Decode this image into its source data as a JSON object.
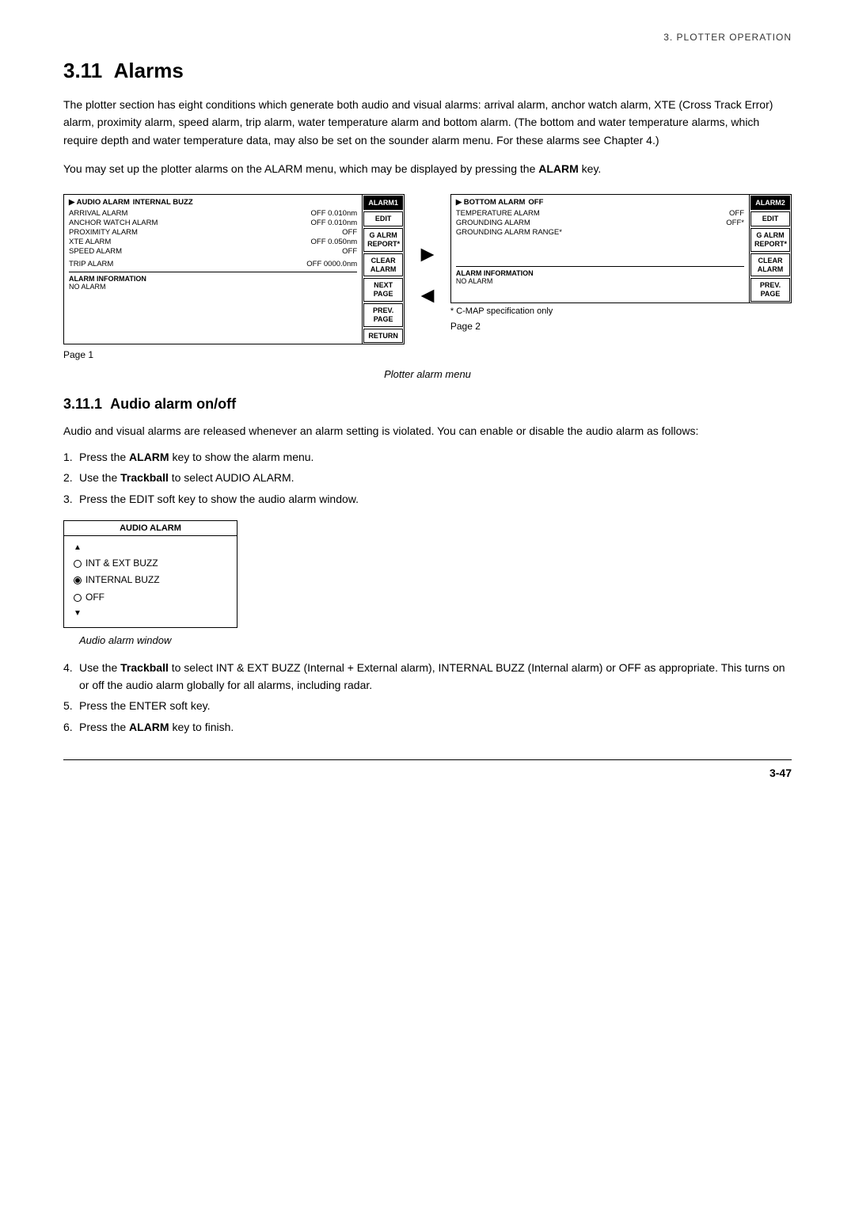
{
  "header": {
    "text": "3.  PLOTTER OPERATION"
  },
  "section": {
    "number": "3.11",
    "title": "Alarms",
    "intro": "The plotter section has eight conditions which generate both audio and visual alarms: arrival alarm, anchor watch alarm, XTE (Cross Track Error) alarm, proximity alarm, speed alarm, trip alarm, water temperature alarm and bottom alarm. (The bottom and water temperature alarms, which require depth and water temperature data, may also be set on the sounder alarm menu. For these alarms see Chapter 4.)",
    "alarm_menu_desc": "You may set up the plotter alarms on the ALARM menu, which may be displayed by pressing the ALARM key."
  },
  "alarm1": {
    "title": "ALARM1",
    "rows": [
      {
        "label": "▶ AUDIO ALARM",
        "value": "INTERNAL BUZZ"
      },
      {
        "label": "ARRIVAL ALARM",
        "value": "OFF 0.010nm"
      },
      {
        "label": "ANCHOR WATCH ALARM",
        "value": "OFF 0.010nm"
      },
      {
        "label": "PROXIMITY ALARM",
        "value": "OFF"
      },
      {
        "label": "XTE ALARM",
        "value": "OFF  0.050nm"
      },
      {
        "label": "SPEED ALARM",
        "value": "OFF"
      },
      {
        "label": "TRIP ALARM",
        "value": "OFF 0000.0nm"
      }
    ],
    "info_label": "ALARM INFORMATION",
    "info_value": "NO ALARM",
    "buttons": [
      "EDIT",
      "G ALRM\nREPORT*",
      "CLEAR\nALARM",
      "NEXT\nPAGE",
      "PREV.\nPAGE",
      "RETURN"
    ],
    "next_page_buttons": [
      "NEXT\nPAGE",
      "PREV.\nPAGE"
    ]
  },
  "alarm2": {
    "title": "ALARM2",
    "rows": [
      {
        "label": "▶ BOTTOM ALARM",
        "value": "OFF"
      },
      {
        "label": "TEMPERATURE ALARM",
        "value": "OFF"
      },
      {
        "label": "GROUNDING ALARM",
        "value": "OFF*"
      },
      {
        "label": "GROUNDING ALARM RANGE*",
        "value": ""
      }
    ],
    "info_label": "ALARM INFORMATION",
    "info_value": "NO ALARM",
    "buttons": [
      "EDIT",
      "G ALRM\nREPORT*",
      "CLEAR\nALARM",
      "PREV.\nPAGE"
    ],
    "c_map_note": "* C-MAP specification only"
  },
  "diagram_caption": "Plotter alarm menu",
  "page1_label": "Page 1",
  "page2_label": "Page 2",
  "subsection": {
    "number": "3.11.1",
    "title": "Audio alarm on/off",
    "description": "Audio and visual alarms are released whenever an alarm setting is violated. You can enable or disable the audio alarm as follows:",
    "steps": [
      {
        "num": "1.",
        "text": "Press the ALARM key to show the alarm menu.",
        "bold_word": "ALARM"
      },
      {
        "num": "2.",
        "text": "Use the Trackball to select AUDIO ALARM.",
        "bold_word": "Trackball"
      },
      {
        "num": "3.",
        "text": "Press the EDIT soft key to show the audio alarm window.",
        "bold_word": ""
      }
    ],
    "audio_window": {
      "title": "AUDIO ALARM",
      "options": [
        {
          "label": "INT & EXT BUZZ",
          "selected": false
        },
        {
          "label": "INTERNAL BUZZ",
          "selected": true
        },
        {
          "label": "OFF",
          "selected": false
        }
      ]
    },
    "audio_caption": "Audio alarm window",
    "steps2": [
      {
        "num": "4.",
        "text": "Use the Trackball to select INT & EXT BUZZ (Internal + External alarm), INTERNAL BUZZ (Internal alarm) or OFF as appropriate. This turns on or off the audio alarm globally for all alarms, including radar.",
        "bold_word": "Trackball"
      },
      {
        "num": "5.",
        "text": "Press the ENTER soft key.",
        "bold_word": ""
      },
      {
        "num": "6.",
        "text": "Press the ALARM key to finish.",
        "bold_word": "ALARM"
      }
    ]
  },
  "footer": {
    "page": "3-47"
  }
}
